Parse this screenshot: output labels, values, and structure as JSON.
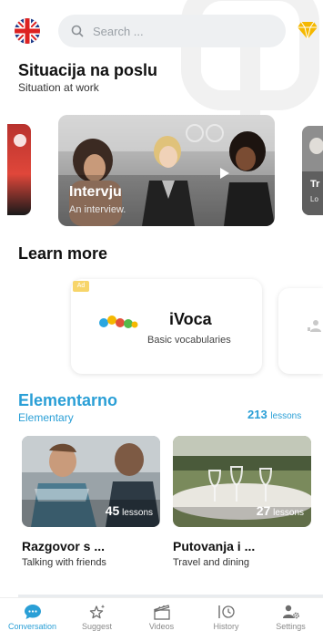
{
  "search": {
    "placeholder": "Search ..."
  },
  "section_work": {
    "title": "Situacija na poslu",
    "subtitle": "Situation at work"
  },
  "carousel": {
    "main": {
      "title": "Intervju",
      "subtitle": "An interview."
    },
    "right_peek": {
      "title": "Tr",
      "subtitle": "Lo"
    }
  },
  "learn_more": {
    "title": "Learn more",
    "ad": {
      "badge": "Ad",
      "title": "iVoca",
      "subtitle": "Basic vocabularies"
    }
  },
  "elementary": {
    "title": "Elementarno",
    "subtitle": "Elementary",
    "count": "213",
    "count_label": "lessons",
    "cards": [
      {
        "count": "45",
        "count_label": "lessons",
        "title": "Razgovor s ...",
        "subtitle": "Talking with friends"
      },
      {
        "count": "27",
        "count_label": "lessons",
        "title": "Putovanja i ...",
        "subtitle": "Travel and dining"
      }
    ]
  },
  "nav": {
    "items": [
      {
        "label": "Conversation",
        "icon": "chat-bubble-icon",
        "active": true
      },
      {
        "label": "Suggest",
        "icon": "sparkle-star-icon",
        "active": false
      },
      {
        "label": "Videos",
        "icon": "clapperboard-icon",
        "active": false
      },
      {
        "label": "History",
        "icon": "clock-history-icon",
        "active": false
      },
      {
        "label": "Settings",
        "icon": "user-gear-icon",
        "active": false
      }
    ]
  },
  "colors": {
    "accent": "#2a9fd6",
    "ad_badge": "#f7d56a",
    "gem": "#f5b800"
  }
}
